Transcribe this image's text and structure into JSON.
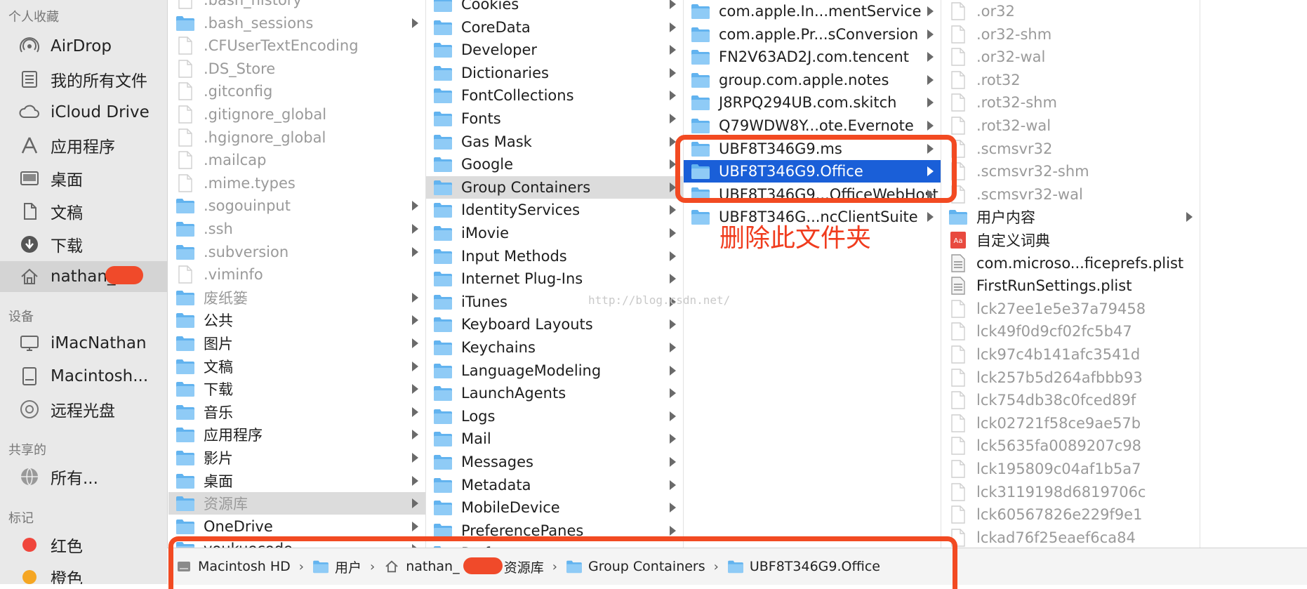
{
  "sidebar": {
    "favorites_header": "个人收藏",
    "favorites": [
      {
        "label": "AirDrop",
        "icon": "airdrop-icon"
      },
      {
        "label": "我的所有文件",
        "icon": "all-files-icon"
      },
      {
        "label": "iCloud Drive",
        "icon": "cloud-icon"
      },
      {
        "label": "应用程序",
        "icon": "applications-icon"
      },
      {
        "label": "桌面",
        "icon": "desktop-icon"
      },
      {
        "label": "文稿",
        "icon": "documents-icon"
      },
      {
        "label": "下载",
        "icon": "downloads-icon"
      },
      {
        "label": "nathan_",
        "icon": "home-icon"
      }
    ],
    "devices_header": "设备",
    "devices": [
      {
        "label": "iMacNathan",
        "icon": "imac-icon"
      },
      {
        "label": "Macintosh...",
        "icon": "disk-icon"
      },
      {
        "label": "远程光盘",
        "icon": "remote-disc-icon"
      }
    ],
    "shared_header": "共享的",
    "shared": [
      {
        "label": "所有...",
        "icon": "network-icon"
      }
    ],
    "tags_header": "标记",
    "tags": [
      {
        "label": "红色",
        "color": "#f0463c"
      },
      {
        "label": "橙色",
        "color": "#f5a623"
      }
    ]
  },
  "columns": {
    "home": [
      {
        "name": ".bash_history",
        "type": "file",
        "hidden": true
      },
      {
        "name": ".bash_sessions",
        "type": "folder",
        "hidden": true,
        "arrow": true
      },
      {
        "name": ".CFUserTextEncoding",
        "type": "file",
        "hidden": true
      },
      {
        "name": ".DS_Store",
        "type": "file",
        "hidden": true
      },
      {
        "name": ".gitconfig",
        "type": "file",
        "hidden": true
      },
      {
        "name": ".gitignore_global",
        "type": "file",
        "hidden": true
      },
      {
        "name": ".hgignore_global",
        "type": "file",
        "hidden": true
      },
      {
        "name": ".mailcap",
        "type": "file",
        "hidden": true
      },
      {
        "name": ".mime.types",
        "type": "file",
        "hidden": true
      },
      {
        "name": ".sogouinput",
        "type": "folder",
        "hidden": true,
        "arrow": true
      },
      {
        "name": ".ssh",
        "type": "folder",
        "hidden": true,
        "arrow": true
      },
      {
        "name": ".subversion",
        "type": "folder",
        "hidden": true,
        "arrow": true
      },
      {
        "name": ".viminfo",
        "type": "file",
        "hidden": true
      },
      {
        "name": "废纸篓",
        "type": "folder",
        "hidden": true,
        "arrow": true
      },
      {
        "name": "公共",
        "type": "folder",
        "arrow": true
      },
      {
        "name": "图片",
        "type": "folder",
        "arrow": true
      },
      {
        "name": "文稿",
        "type": "folder",
        "arrow": true
      },
      {
        "name": "下载",
        "type": "folder",
        "arrow": true
      },
      {
        "name": "音乐",
        "type": "folder",
        "arrow": true
      },
      {
        "name": "应用程序",
        "type": "folder",
        "arrow": true
      },
      {
        "name": "影片",
        "type": "folder",
        "arrow": true
      },
      {
        "name": "桌面",
        "type": "folder",
        "arrow": true
      },
      {
        "name": "资源库",
        "type": "folder",
        "hidden": true,
        "arrow": true,
        "selected": "gray"
      },
      {
        "name": "OneDrive",
        "type": "folder",
        "arrow": true
      },
      {
        "name": "youkuecode",
        "type": "folder",
        "arrow": true
      }
    ],
    "library": [
      {
        "name": "Cookies",
        "type": "folder",
        "arrow": true
      },
      {
        "name": "CoreData",
        "type": "folder",
        "arrow": true
      },
      {
        "name": "Developer",
        "type": "folder",
        "arrow": true
      },
      {
        "name": "Dictionaries",
        "type": "folder",
        "arrow": true
      },
      {
        "name": "FontCollections",
        "type": "folder",
        "arrow": true
      },
      {
        "name": "Fonts",
        "type": "folder",
        "arrow": true
      },
      {
        "name": "Gas Mask",
        "type": "folder",
        "arrow": true
      },
      {
        "name": "Google",
        "type": "folder",
        "arrow": true
      },
      {
        "name": "Group Containers",
        "type": "folder",
        "arrow": true,
        "selected": "gray"
      },
      {
        "name": "IdentityServices",
        "type": "folder",
        "arrow": true
      },
      {
        "name": "iMovie",
        "type": "folder",
        "arrow": true
      },
      {
        "name": "Input Methods",
        "type": "folder",
        "arrow": true
      },
      {
        "name": "Internet Plug-Ins",
        "type": "folder",
        "arrow": true
      },
      {
        "name": "iTunes",
        "type": "folder",
        "arrow": true
      },
      {
        "name": "Keyboard Layouts",
        "type": "folder",
        "arrow": true
      },
      {
        "name": "Keychains",
        "type": "folder",
        "arrow": true
      },
      {
        "name": "LanguageModeling",
        "type": "folder",
        "arrow": true
      },
      {
        "name": "LaunchAgents",
        "type": "folder",
        "arrow": true
      },
      {
        "name": "Logs",
        "type": "folder",
        "arrow": true
      },
      {
        "name": "Mail",
        "type": "folder",
        "arrow": true
      },
      {
        "name": "Messages",
        "type": "folder",
        "arrow": true
      },
      {
        "name": "Metadata",
        "type": "folder",
        "arrow": true
      },
      {
        "name": "MobileDevice",
        "type": "folder",
        "arrow": true
      },
      {
        "name": "PreferencePanes",
        "type": "folder",
        "arrow": true
      },
      {
        "name": "Preferences",
        "type": "folder",
        "arrow": true
      }
    ],
    "group_containers": [
      {
        "name": "com.apple.In...mentService",
        "type": "folder",
        "arrow": true
      },
      {
        "name": "com.apple.Pr...sConversion",
        "type": "folder",
        "arrow": true
      },
      {
        "name": "FN2V63AD2J.com.tencent",
        "type": "folder",
        "arrow": true
      },
      {
        "name": "group.com.apple.notes",
        "type": "folder",
        "arrow": true
      },
      {
        "name": "J8RPQ294UB.com.skitch",
        "type": "folder",
        "arrow": true
      },
      {
        "name": "Q79WDW8Y...ote.Evernote",
        "type": "folder",
        "arrow": true
      },
      {
        "name": "UBF8T346G9.ms",
        "type": "folder",
        "arrow": true
      },
      {
        "name": "UBF8T346G9.Office",
        "type": "folder",
        "arrow": true,
        "selected": "blue"
      },
      {
        "name": "UBF8T346G9...OfficeWebHost",
        "type": "folder",
        "arrow": true
      },
      {
        "name": "UBF8T346G...ncClientSuite",
        "type": "folder",
        "arrow": true
      }
    ],
    "office": [
      {
        "name": ".or32",
        "type": "file",
        "hidden": true
      },
      {
        "name": ".or32-shm",
        "type": "file",
        "hidden": true
      },
      {
        "name": ".or32-wal",
        "type": "file",
        "hidden": true
      },
      {
        "name": ".rot32",
        "type": "file",
        "hidden": true
      },
      {
        "name": ".rot32-shm",
        "type": "file",
        "hidden": true
      },
      {
        "name": ".rot32-wal",
        "type": "file",
        "hidden": true
      },
      {
        "name": ".scmsvr32",
        "type": "file",
        "hidden": true
      },
      {
        "name": ".scmsvr32-shm",
        "type": "file",
        "hidden": true
      },
      {
        "name": ".scmsvr32-wal",
        "type": "file",
        "hidden": true
      },
      {
        "name": "用户内容",
        "type": "folder",
        "arrow": true
      },
      {
        "name": "自定义词典",
        "type": "dict"
      },
      {
        "name": "com.microso...ficeprefs.plist",
        "type": "plist"
      },
      {
        "name": "FirstRunSettings.plist",
        "type": "plist"
      },
      {
        "name": "lck27ee1e5e37a79458",
        "type": "file",
        "hidden": true
      },
      {
        "name": "lck49f0d9cf02fc5b47",
        "type": "file",
        "hidden": true
      },
      {
        "name": "lck97c4b141afc3541d",
        "type": "file",
        "hidden": true
      },
      {
        "name": "lck257b5d264afbbb93",
        "type": "file",
        "hidden": true
      },
      {
        "name": "lck754db38c0fced89f",
        "type": "file",
        "hidden": true
      },
      {
        "name": "lck02721f58ce9ae57b",
        "type": "file",
        "hidden": true
      },
      {
        "name": "lck5635fa0089207c98",
        "type": "file",
        "hidden": true
      },
      {
        "name": "lck195809c04af1b5a7",
        "type": "file",
        "hidden": true
      },
      {
        "name": "lck3119198d6819706c",
        "type": "file",
        "hidden": true
      },
      {
        "name": "lck60567826e229f9e1",
        "type": "file",
        "hidden": true
      },
      {
        "name": "lckad76f25eaef6ca84",
        "type": "file",
        "hidden": true
      }
    ]
  },
  "pathbar": [
    {
      "label": "Macintosh HD",
      "icon": "hard-disk-icon"
    },
    {
      "label": "用户",
      "icon": "folder-icon"
    },
    {
      "label": "nathan_",
      "icon": "home-icon"
    },
    {
      "label": "资源库",
      "icon": "folder-icon"
    },
    {
      "label": "Group Containers",
      "icon": "folder-icon"
    },
    {
      "label": "UBF8T346G9.Office",
      "icon": "folder-icon"
    }
  ],
  "annotation": {
    "text": "删除此文件夹",
    "color": "#f24a22"
  },
  "watermark": "http://blog.csdn.net/",
  "colors": {
    "selection_blue": "#1a5fd8",
    "folder_blue": "#5eb2f0",
    "annotation_red": "#f24a22"
  }
}
